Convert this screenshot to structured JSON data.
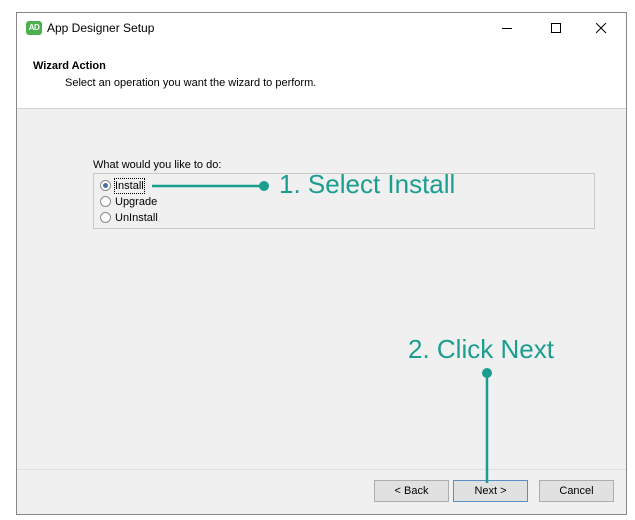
{
  "window": {
    "title": "App Designer Setup",
    "app_icon_text": "AD",
    "controls": [
      "minimize-icon",
      "maximize-icon",
      "close-icon"
    ]
  },
  "header": {
    "title": "Wizard Action",
    "subtitle": "Select an operation you want the wizard to perform."
  },
  "main": {
    "question": "What would you like to do:",
    "options": [
      {
        "label": "Install",
        "checked": true
      },
      {
        "label": "Upgrade",
        "checked": false
      },
      {
        "label": "UnInstall",
        "checked": false
      }
    ]
  },
  "buttons": {
    "back": "< Back",
    "next": "Next >",
    "cancel": "Cancel"
  },
  "annotations": {
    "step1": "1. Select Install",
    "step2": "2. Click Next",
    "color": "#1a9e8f"
  }
}
